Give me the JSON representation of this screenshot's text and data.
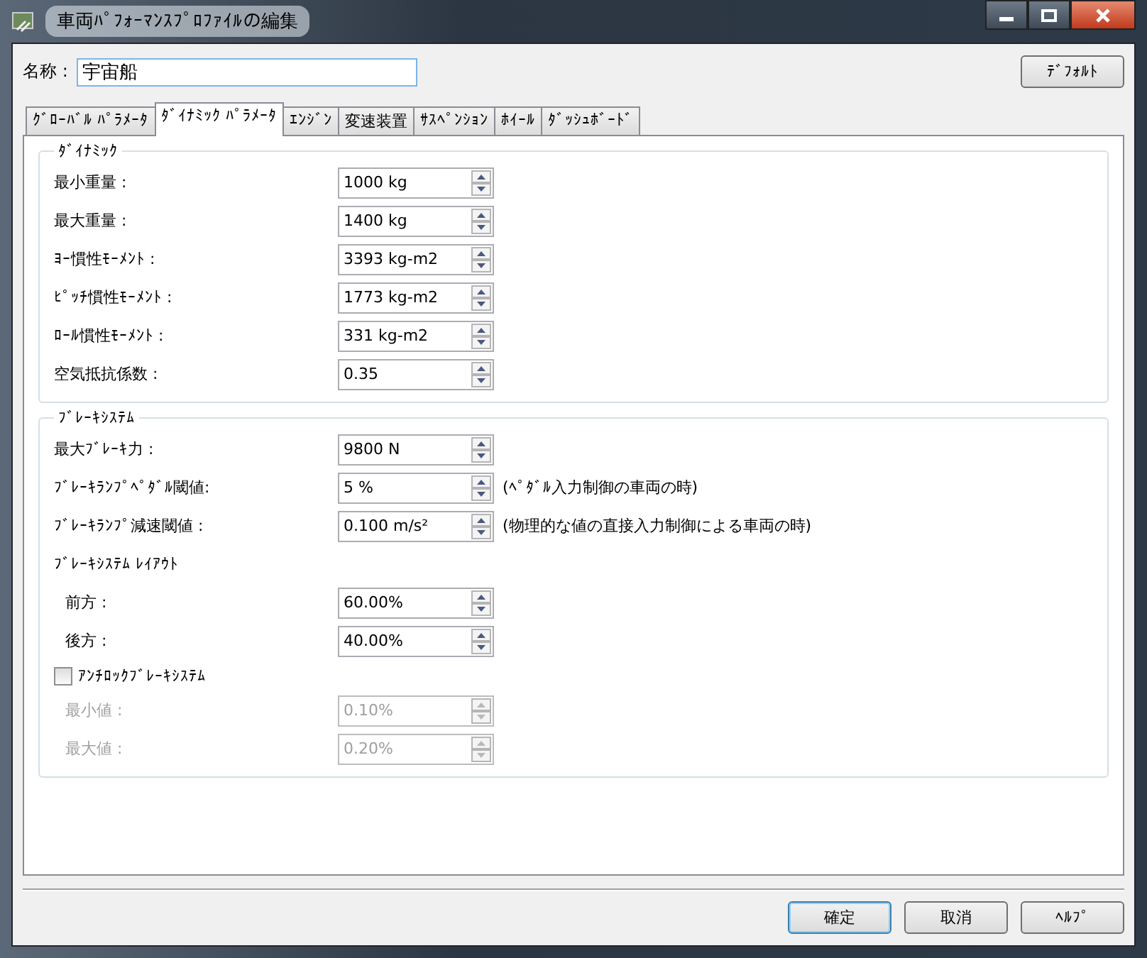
{
  "window": {
    "title": "車両ﾊﾟﾌｫｰﾏﾝｽﾌﾟﾛﾌｧｲﾙの編集"
  },
  "name_field": {
    "label": "名称 :",
    "value": "宇宙船"
  },
  "default_button": "ﾃﾞﾌｫﾙﾄ",
  "tabs": [
    {
      "label": "ｸﾞﾛｰﾊﾞﾙ ﾊﾟﾗﾒｰﾀ",
      "selected": false
    },
    {
      "label": "ﾀﾞｲﾅﾐｯｸ ﾊﾟﾗﾒｰﾀ",
      "selected": true
    },
    {
      "label": "ｴﾝｼﾞﾝ",
      "selected": false
    },
    {
      "label": "変速装置",
      "selected": false
    },
    {
      "label": "ｻｽﾍﾟﾝｼｮﾝ",
      "selected": false
    },
    {
      "label": "ﾎｲｰﾙ",
      "selected": false
    },
    {
      "label": "ﾀﾞｯｼｭﾎﾞｰﾄﾞ",
      "selected": false
    }
  ],
  "groups": [
    {
      "title": "ﾀﾞｲﾅﾐｯｸ",
      "rows": [
        {
          "kind": "spin",
          "label": "最小重量 :",
          "value": "1000 kg",
          "disabled": false
        },
        {
          "kind": "spin",
          "label": "最大重量 :",
          "value": "1400 kg",
          "disabled": false
        },
        {
          "kind": "spin",
          "label": "ﾖｰ慣性ﾓｰﾒﾝﾄ :",
          "value": "3393 kg-m2",
          "disabled": false
        },
        {
          "kind": "spin",
          "label": "ﾋﾟｯﾁ慣性ﾓｰﾒﾝﾄ :",
          "value": "1773 kg-m2",
          "disabled": false
        },
        {
          "kind": "spin",
          "label": "ﾛｰﾙ慣性ﾓｰﾒﾝﾄ :",
          "value": "331 kg-m2",
          "disabled": false
        },
        {
          "kind": "spin",
          "label": "空気抵抗係数 :",
          "value": "0.35",
          "disabled": false
        }
      ]
    },
    {
      "title": "ﾌﾞﾚｰｷｼｽﾃﾑ",
      "rows": [
        {
          "kind": "spin",
          "label": "最大ﾌﾞﾚｰｷ力 :",
          "value": "9800 N",
          "disabled": false
        },
        {
          "kind": "spin",
          "label": "ﾌﾞﾚｰｷﾗﾝﾌﾟﾍﾟﾀﾞﾙ閾値:",
          "value": "5 %",
          "note": "(ﾍﾟﾀﾞﾙ入力制御の車両の時)",
          "disabled": false
        },
        {
          "kind": "spin",
          "label": "ﾌﾞﾚｰｷﾗﾝﾌﾟ減速閾値 :",
          "value": "0.100 m/s²",
          "note": "(物理的な値の直接入力制御による車両の時)",
          "disabled": false
        },
        {
          "kind": "heading",
          "label": "ﾌﾞﾚｰｷｼｽﾃﾑ ﾚｲｱｳﾄ",
          "children": [
            {
              "kind": "spin",
              "label": "前方 :",
              "value": "60.00%",
              "disabled": false
            },
            {
              "kind": "spin",
              "label": "後方 :",
              "value": "40.00%",
              "disabled": false
            }
          ]
        },
        {
          "kind": "checkbox",
          "label": "ｱﾝﾁﾛｯｸﾌﾞﾚｰｷｼｽﾃﾑ",
          "checked": false,
          "children": [
            {
              "kind": "spin",
              "label": "最小値 :",
              "value": "0.10%",
              "disabled": true
            },
            {
              "kind": "spin",
              "label": "最大値 :",
              "value": "0.20%",
              "disabled": true
            }
          ]
        }
      ]
    }
  ],
  "buttons": [
    {
      "label": "確定",
      "focused": true
    },
    {
      "label": "取消",
      "focused": false
    },
    {
      "label": "ﾍﾙﾌﾟ",
      "focused": false
    }
  ]
}
